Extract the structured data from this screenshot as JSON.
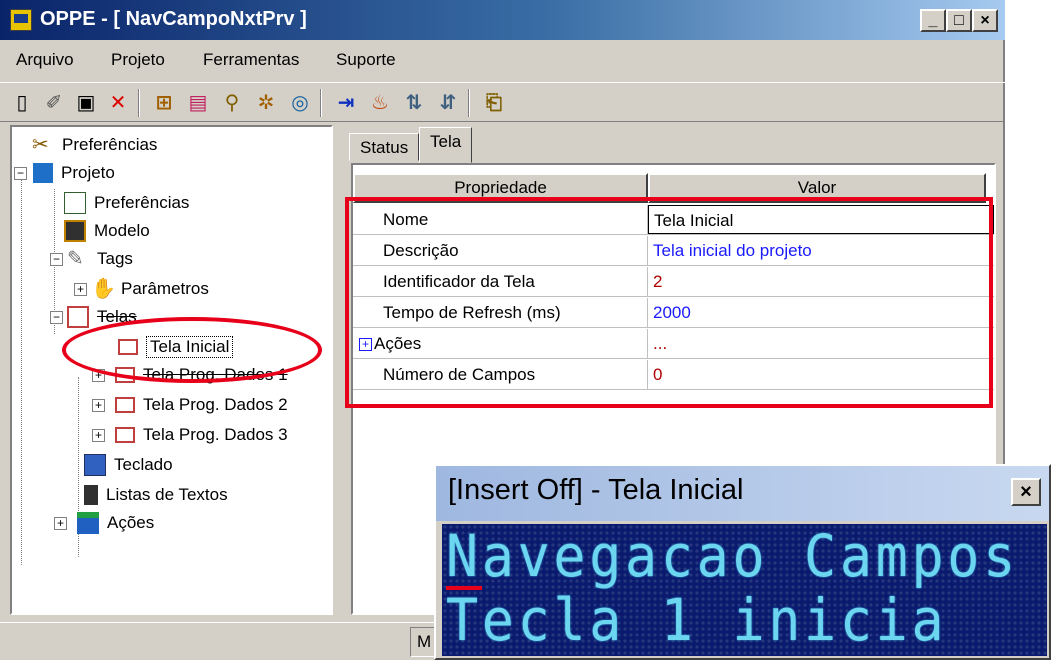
{
  "window": {
    "title": "OPPE - [ NavCampoNxtPrv ]",
    "min": "_",
    "max": "□",
    "close": "×"
  },
  "menu": {
    "arquivo": "Arquivo",
    "projeto": "Projeto",
    "ferramentas": "Ferramentas",
    "suporte": "Suporte"
  },
  "tree": {
    "preferencias_root": "Preferências",
    "projeto": "Projeto",
    "preferencias": "Preferências",
    "modelo": "Modelo",
    "tags": "Tags",
    "parametros": "Parâmetros",
    "telas": "Telas",
    "tela_inicial": "Tela Inicial",
    "tela_prog1": "Tela Prog. Dados 1",
    "tela_prog2": "Tela Prog. Dados 2",
    "tela_prog3": "Tela Prog. Dados 3",
    "teclado": "Teclado",
    "listas": "Listas de Textos",
    "acoes": "Ações"
  },
  "tabs": {
    "status": "Status",
    "tela": "Tela"
  },
  "grid": {
    "col_prop": "Propriedade",
    "col_valor": "Valor",
    "rows": [
      {
        "prop": "Nome",
        "valor": "Tela Inicial",
        "color": "#000000"
      },
      {
        "prop": "Descrição",
        "valor": "Tela inicial do projeto",
        "color": "#1a1aff"
      },
      {
        "prop": "Identificador da Tela",
        "valor": "2",
        "color": "#b00000"
      },
      {
        "prop": "Tempo de Refresh (ms)",
        "valor": "2000",
        "color": "#1a1aff"
      },
      {
        "prop": "Ações",
        "valor": "...",
        "color": "#b00000"
      },
      {
        "prop": "Número de Campos",
        "valor": "0",
        "color": "#b00000"
      }
    ]
  },
  "status": {
    "panel": "M"
  },
  "lcd": {
    "title": "[Insert Off] - Tela Inicial",
    "close": "×",
    "line1": "Navegacao Campos",
    "line2": " Tecla 1 inicia"
  }
}
